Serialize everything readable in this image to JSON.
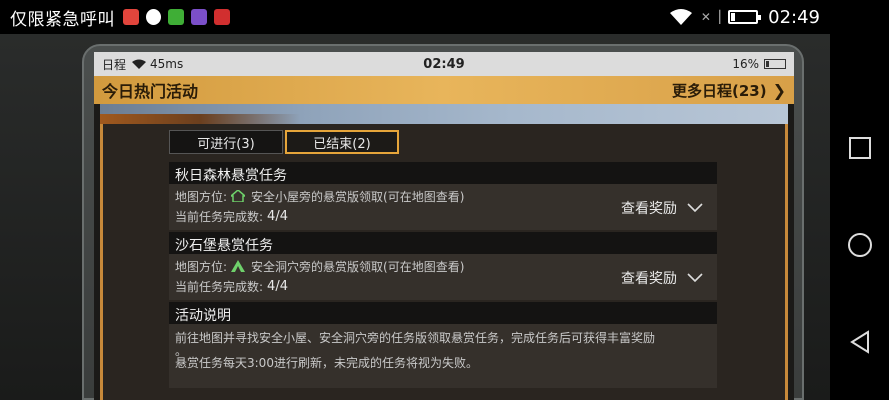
{
  "phone_status": {
    "carrier": "仅限紧急呼叫",
    "time": "02:49"
  },
  "game_status": {
    "left": "日程",
    "ping": "45ms",
    "time": "02:49",
    "battery": "16%"
  },
  "header": {
    "title": "今日热门活动",
    "more": "更多日程(23)"
  },
  "tabs": [
    {
      "label": "可进行(3)",
      "active": false
    },
    {
      "label": "已结束(2)",
      "active": true
    }
  ],
  "tasks": [
    {
      "title": "秋日森林悬赏任务",
      "location_label": "地图方位:",
      "location_value": "安全小屋旁的悬赏版领取(可在地图查看)",
      "progress_label": "当前任务完成数:",
      "progress_value": "4/4",
      "reward": "查看奖励",
      "icon": "house-icon"
    },
    {
      "title": "沙石堡悬赏任务",
      "location_label": "地图方位:",
      "location_value": "安全洞穴旁的悬赏版领取(可在地图查看)",
      "progress_label": "当前任务完成数:",
      "progress_value": "4/4",
      "reward": "查看奖励",
      "icon": "cave-icon"
    }
  ],
  "description": {
    "title": "活动说明",
    "line1": "前往地图并寻找安全小屋、安全洞穴旁的任务版领取悬赏任务，完成任务后可获得丰富奖励",
    "line2": "。",
    "line3": "悬赏任务每天3:00进行刷新，未完成的任务将视为失败。"
  },
  "colors": {
    "accent": "#e6a53a",
    "header": "#d8a048"
  }
}
